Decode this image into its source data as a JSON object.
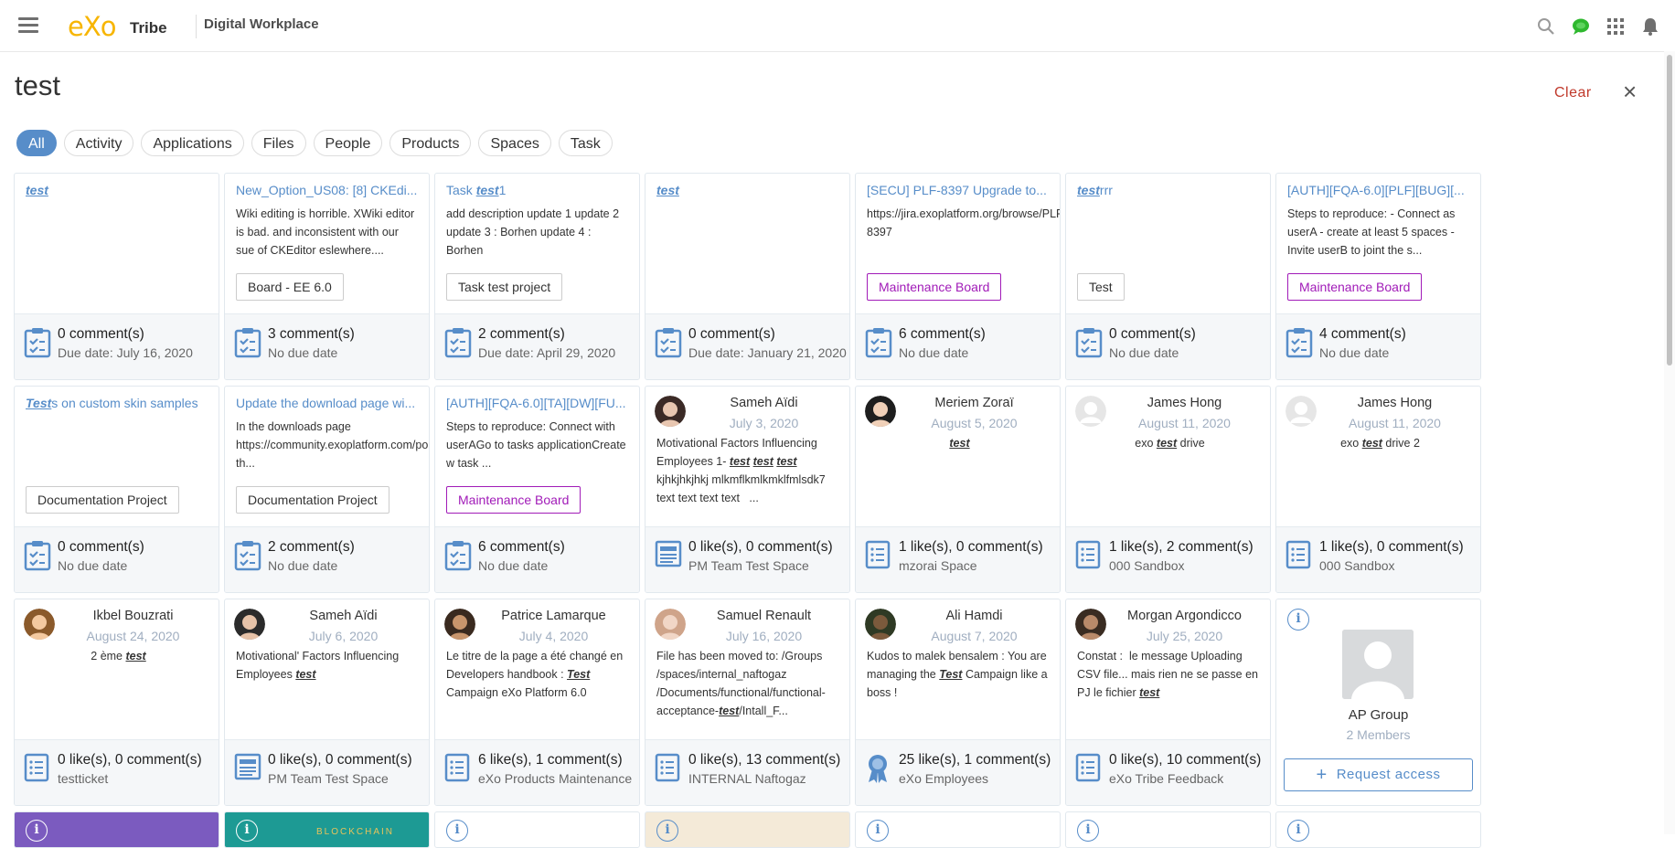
{
  "topbar": {
    "logo": "eXo",
    "brand": "Tribe",
    "app_title": "Digital Workplace"
  },
  "search": {
    "query": "test",
    "clear_label": "Clear",
    "close_label": "×"
  },
  "filters": [
    "All",
    "Activity",
    "Applications",
    "Files",
    "People",
    "Products",
    "Spaces",
    "Task"
  ],
  "colors": {
    "accent": "#578dc9",
    "brand": "#f7b500",
    "board_purple": "#a11bb8",
    "clear_red": "#c0392b",
    "chat_green": "#2eb82e"
  },
  "task_cards": [
    {
      "title_pre": "",
      "title_hl": "test",
      "title_post": "",
      "desc": "",
      "project": "",
      "purple": false,
      "comments": "0 comment(s)",
      "due": "Due date: July 16, 2020"
    },
    {
      "title_pre": "New_Option_US08: [8] CKEdi...",
      "title_hl": "",
      "title_post": "",
      "desc": "Wiki editing is horrible. XWiki editor is bad. and inconsistent with our sue of CKEditor eslewhere....",
      "project": "Board - EE 6.0",
      "purple": false,
      "comments": "3 comment(s)",
      "due": "No due date"
    },
    {
      "title_pre": "Task ",
      "title_hl": "test",
      "title_post": "1",
      "desc": "add description update 1 update 2 update 3 : Borhen update 4 : Borhen",
      "project": "Task test project",
      "purple": false,
      "comments": "2 comment(s)",
      "due": "Due date: April 29, 2020"
    },
    {
      "title_pre": "",
      "title_hl": "test",
      "title_post": "",
      "desc": "",
      "project": "",
      "purple": false,
      "comments": "0 comment(s)",
      "due": "Due date: January 21, 2020"
    },
    {
      "title_pre": "[SECU] PLF-8397 Upgrade to...",
      "title_hl": "",
      "title_post": "",
      "desc": "https://jira.exoplatform.org/browse/PLF-8397",
      "project": "Maintenance Board",
      "purple": true,
      "comments": "6 comment(s)",
      "due": "No due date"
    },
    {
      "title_pre": "",
      "title_hl": "test",
      "title_post": "rrr",
      "desc": "",
      "project": "Test",
      "purple": false,
      "comments": "0 comment(s)",
      "due": "No due date"
    },
    {
      "title_pre": "[AUTH][FQA-6.0][PLF][BUG][...",
      "title_hl": "",
      "title_post": "",
      "desc": "Steps to reproduce: - Connect as userA - create at least 5 spaces - Invite userB to joint the s...",
      "project": "Maintenance Board",
      "purple": true,
      "comments": "4 comment(s)",
      "due": "No due date"
    },
    {
      "title_pre": "",
      "title_hl": "Test",
      "title_post": "s on custom skin samples",
      "desc": "",
      "project": "Documentation Project",
      "purple": false,
      "comments": "0 comment(s)",
      "due": "No due date"
    },
    {
      "title_pre": "Update the download page wi...",
      "title_hl": "",
      "title_post": "",
      "desc": "In the downloads page https://community.exoplatform.com/portal/intranet/downloads, th...",
      "project": "Documentation Project",
      "purple": false,
      "comments": "2 comment(s)",
      "due": "No due date"
    },
    {
      "title_pre": "[AUTH][FQA-6.0][TA][DW][FU...",
      "title_hl": "",
      "title_post": "",
      "desc": "Steps to reproduce: Connect with userAGo to tasks applicationCreate w task ...",
      "project": "Maintenance Board",
      "purple": true,
      "comments": "6 comment(s)",
      "due": "No due date"
    }
  ],
  "activity_cards": [
    {
      "name": "Sameh Aïdi",
      "date": "July 3, 2020",
      "html": "Motivational Factors Influencing Employees 1- <span class=\"hl\">test</span> <span class=\"hl\">test</span> <span class=\"hl\">test</span> kjhkjhkjhkj mlkmflkmlkmklfmlsdk7 text text text text &nbsp;&nbsp;...",
      "center": false,
      "stats": "0 like(s), 0 comment(s)",
      "space": "PM Team Test Space",
      "icon": "page"
    },
    {
      "name": "Meriem Zoraï",
      "date": "August 5, 2020",
      "html": "<span class=\"hl\">test</span>",
      "center": true,
      "stats": "1 like(s), 0 comment(s)",
      "space": "mzorai Space",
      "icon": "list"
    },
    {
      "name": "James Hong",
      "date": "August 11, 2020",
      "html": "exo <span class=\"hl\">test</span> drive",
      "center": true,
      "stats": "1 like(s), 2 comment(s)",
      "space": "000 Sandbox",
      "icon": "list"
    },
    {
      "name": "James Hong",
      "date": "August 11, 2020",
      "html": "exo <span class=\"hl\">test</span> drive 2",
      "center": true,
      "stats": "1 like(s), 0 comment(s)",
      "space": "000 Sandbox",
      "icon": "list"
    },
    {
      "name": "Ikbel Bouzrati",
      "date": "August 24, 2020",
      "html": "2 ème <span class=\"hl\">test</span>",
      "center": true,
      "stats": "0 like(s), 0 comment(s)",
      "space": "testticket",
      "icon": "list"
    },
    {
      "name": "Sameh Aïdi",
      "date": "July 6, 2020",
      "html": "Motivational' Factors Influencing Employees <span class=\"hl\">test</span>",
      "center": false,
      "stats": "0 like(s), 0 comment(s)",
      "space": "PM Team Test Space",
      "icon": "page"
    },
    {
      "name": "Patrice Lamarque",
      "date": "July 4, 2020",
      "html": "Le titre de la page a été changé en Developers handbook : <span class=\"hl\">Test</span> Campaign eXo Platform 6.0",
      "center": false,
      "stats": "6 like(s), 1 comment(s)",
      "space": "eXo Products Maintenance",
      "icon": "list"
    },
    {
      "name": "Samuel Renault",
      "date": "July 16, 2020",
      "html": "File has been moved to: /Groups /spaces/internal_naftogaz /Documents/functional/functional-acceptance-<span class=\"hl\">test</span>/Intall_F...",
      "center": false,
      "stats": "0 like(s), 13 comment(s)",
      "space": "INTERNAL Naftogaz",
      "icon": "list"
    },
    {
      "name": "Ali Hamdi",
      "date": "August 7, 2020",
      "html": "Kudos to malek bensalem : You are managing the <span class=\"hl\">Test</span> Campaign like a boss !",
      "center": false,
      "stats": "25 like(s), 1 comment(s)",
      "space": "eXo Employees",
      "icon": "badge"
    },
    {
      "name": "Morgan Argondicco",
      "date": "July 25, 2020",
      "html": "Constat : &nbsp;le message Uploading CSV file... mais rien ne se passe en PJ le fichier <span class=\"hl\">test</span>",
      "center": false,
      "stats": "0 like(s), 10 comment(s)",
      "space": "eXo Tribe Feedback",
      "icon": "list"
    }
  ],
  "space_card": {
    "info": "i",
    "name": "AP Group",
    "members": "2 Members",
    "request_label": "Request access"
  },
  "partial_row": {
    "info": "i",
    "banner_text": "BLOCKCHAIN"
  }
}
